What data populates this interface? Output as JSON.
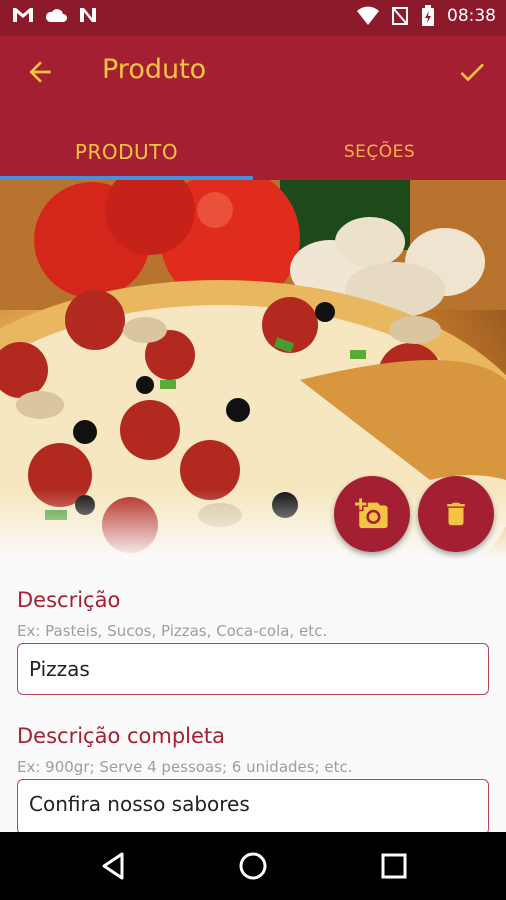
{
  "status_bar": {
    "time": "08:38",
    "left_icons": [
      "gmail-icon",
      "cloud-icon",
      "n-app-icon"
    ],
    "right_icons": [
      "wifi-icon",
      "no-signal-icon",
      "battery-charging-icon"
    ]
  },
  "app_bar": {
    "title": "Produto",
    "back_icon": "arrow-back-icon",
    "confirm_icon": "check-icon"
  },
  "tabs": [
    {
      "label": "PRODUTO",
      "active": true
    },
    {
      "label": "SEÇÕES",
      "active": false
    }
  ],
  "hero": {
    "camera_button_icon": "add-photo-icon",
    "delete_button_icon": "trash-icon"
  },
  "form": {
    "description": {
      "label": "Descrição",
      "hint": "Ex: Pasteis, Sucos, Pizzas, Coca-cola, etc.",
      "value": "Pizzas"
    },
    "full_description": {
      "label": "Descrição completa",
      "hint": "Ex: 900gr; Serve 4 pessoas; 6 unidades; etc.",
      "value": "Confira nosso sabores"
    }
  },
  "nav_bar": {
    "buttons": [
      "back-triangle-icon",
      "home-circle-icon",
      "recents-square-icon"
    ]
  },
  "colors": {
    "primary": "#a51f33",
    "status_bar": "#8c1a2b",
    "accent": "#f4c542",
    "tab_indicator": "#4a90d9"
  }
}
